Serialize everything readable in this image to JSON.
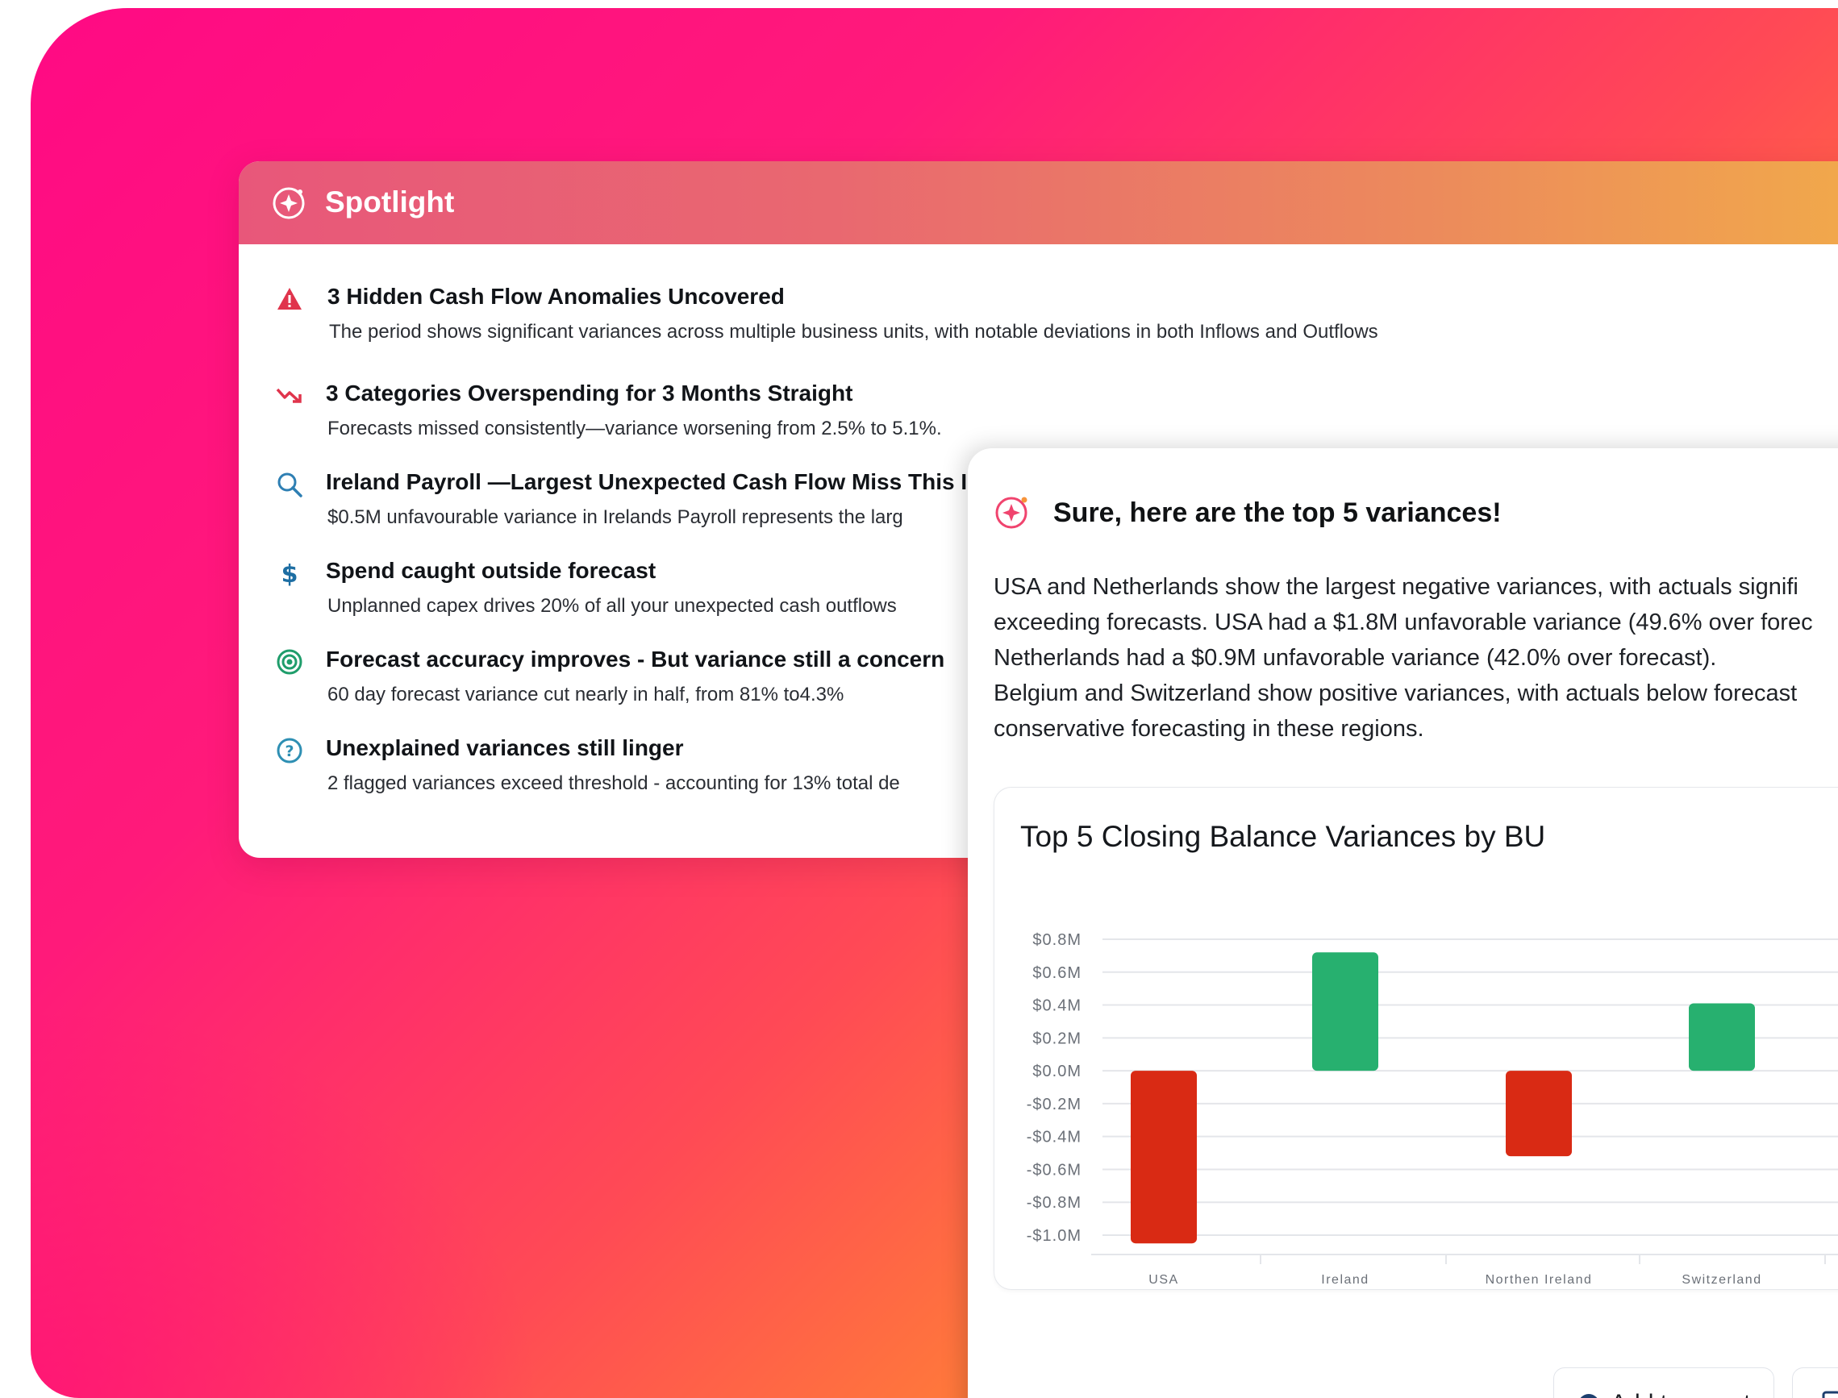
{
  "spotlight": {
    "title": "Spotlight",
    "insights": [
      {
        "icon": "warning-triangle-icon",
        "title": "3 Hidden Cash Flow Anomalies Uncovered",
        "desc": "The period shows significant variances across multiple business units, with notable deviations in both Inflows and Outflows"
      },
      {
        "icon": "trend-down-icon",
        "title": "3 Categories Overspending for 3 Months Straight",
        "desc": "Forecasts missed consistently—variance worsening from 2.5% to 5.1%."
      },
      {
        "icon": "search-icon",
        "title": "Ireland Payroll —Largest Unexpected Cash Flow Miss This I",
        "desc": "$0.5M unfavourable variance in Irelands Payroll represents the larg"
      },
      {
        "icon": "dollar-icon",
        "title": "Spend caught outside forecast",
        "desc": "Unplanned capex drives 20% of all your unexpected cash outflows"
      },
      {
        "icon": "target-icon",
        "title": "Forecast accuracy improves - But variance still a concern",
        "desc": "60 day forecast variance cut nearly in half, from 81% to4.3%"
      },
      {
        "icon": "question-circle-icon",
        "title": "Unexplained variances still linger",
        "desc": "2 flagged variances exceed threshold - accounting for 13% total de"
      }
    ]
  },
  "chat": {
    "title": "Sure, here are the top 5 variances!",
    "paragraph": [
      "USA and Netherlands show the largest negative variances, with actuals signifi",
      "exceeding forecasts. USA had a $1.8M unfavorable variance (49.6% over forec",
      "Netherlands had a $0.9M unfavorable variance (42.0% over forecast).",
      "Belgium and Switzerland show positive variances, with actuals below forecast",
      "conservative forecasting in these regions."
    ],
    "actions": {
      "add_to_report": "Add to report"
    }
  },
  "colors": {
    "positive": "#27b06f",
    "negative": "#d92a14",
    "accent": "#e8577a"
  },
  "chart_data": {
    "type": "bar",
    "title": "Top 5 Closing Balance Variances by BU",
    "categories": [
      "USA",
      "Ireland",
      "Northen Ireland",
      "Switzerland"
    ],
    "values": [
      -1.05,
      0.72,
      -0.52,
      0.41
    ],
    "yticks": [
      "$0.8M",
      "$0.6M",
      "$0.4M",
      "$0.2M",
      "$0.0M",
      "-$0.2M",
      "-$0.4M",
      "-$0.6M",
      "-$0.8M",
      "-$1.0M"
    ],
    "ylim": [
      -1.0,
      0.8
    ],
    "grid": true
  }
}
